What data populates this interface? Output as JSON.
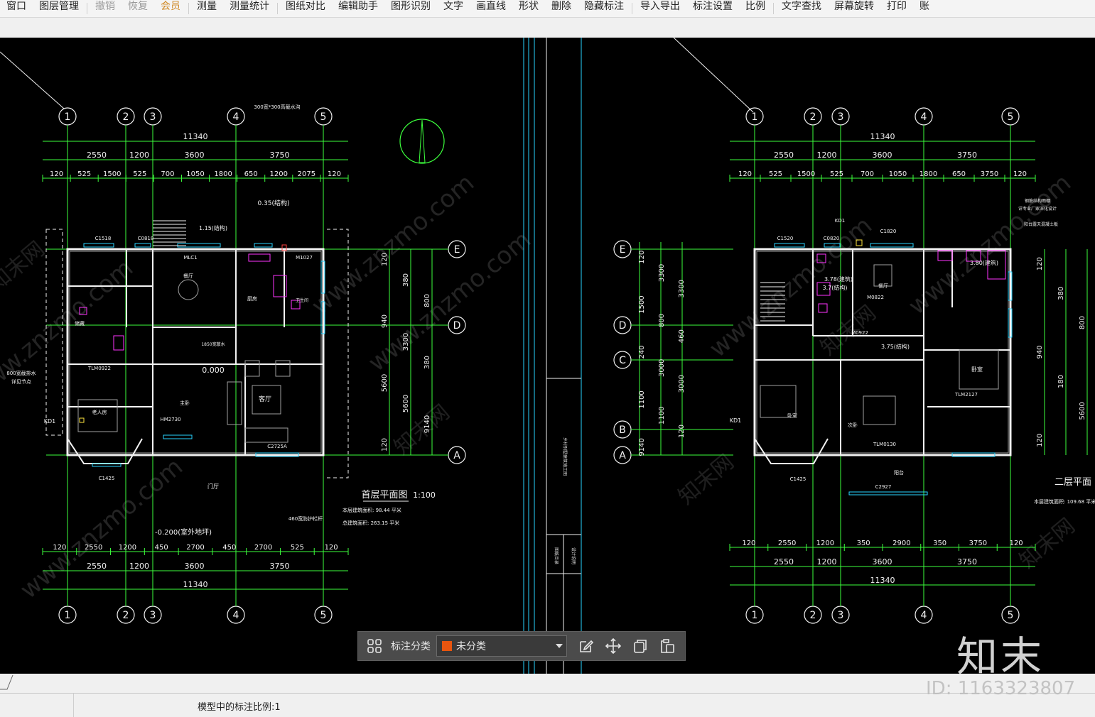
{
  "menu": {
    "items": [
      {
        "label": "窗口",
        "state": "normal"
      },
      {
        "label": "图层管理",
        "state": "normal"
      },
      {
        "label": "撤销",
        "state": "disabled"
      },
      {
        "label": "恢复",
        "state": "disabled"
      },
      {
        "label": "会员",
        "state": "vip"
      },
      {
        "label": "测量",
        "state": "normal"
      },
      {
        "label": "测量统计",
        "state": "normal"
      },
      {
        "label": "图纸对比",
        "state": "normal"
      },
      {
        "label": "编辑助手",
        "state": "normal"
      },
      {
        "label": "图形识别",
        "state": "normal"
      },
      {
        "label": "文字",
        "state": "normal"
      },
      {
        "label": "画直线",
        "state": "normal"
      },
      {
        "label": "形状",
        "state": "normal"
      },
      {
        "label": "删除",
        "state": "normal"
      },
      {
        "label": "隐藏标注",
        "state": "normal"
      },
      {
        "label": "导入导出",
        "state": "normal"
      },
      {
        "label": "标注设置",
        "state": "normal"
      },
      {
        "label": "比例",
        "state": "normal"
      },
      {
        "label": "文字查找",
        "state": "normal"
      },
      {
        "label": "屏幕旋转",
        "state": "normal"
      },
      {
        "label": "打印",
        "state": "normal"
      },
      {
        "label": "账",
        "state": "normal"
      }
    ]
  },
  "drawing": {
    "left": {
      "axis_cols": [
        "1",
        "2",
        "3",
        "4",
        "5"
      ],
      "axis_rows": [
        "E",
        "D",
        "A"
      ],
      "total": "11340",
      "top_dims": [
        "2550",
        "1200",
        "3600",
        "3750"
      ],
      "sub_dims": [
        "120",
        "525",
        "1500",
        "525",
        "700",
        "1050",
        "1800",
        "650",
        "1200",
        "2075",
        "120"
      ],
      "right_dims": [
        "120",
        "380",
        "800",
        "940",
        "3300",
        "380",
        "5600",
        "5600",
        "9140",
        "120"
      ],
      "bottom_dims_1": [
        "120",
        "2550",
        "1200",
        "450",
        "2700",
        "450",
        "2700",
        "525",
        "120"
      ],
      "bottom_dims_2": [
        "2550",
        "1200",
        "3600",
        "3750"
      ],
      "bottom_total": "11340",
      "room_labels": [
        "餐厅",
        "厨房",
        "客厅",
        "老人房",
        "卧室",
        "门厅",
        "次卧",
        "卫生间",
        "储藏"
      ],
      "window_labels": [
        "C1518",
        "C0818",
        "MLC1",
        "M1027",
        "C0824",
        "C1425",
        "C2725A",
        "M0922",
        "TLM0922",
        "HM2730",
        "KD1",
        "C0618",
        "C2718",
        "M0822"
      ],
      "elevations": [
        "0.000",
        "-0.020",
        "-0.200(室外地坪)",
        "1.15(结构)",
        "0.35(结构)"
      ],
      "notes": [
        "300宽*300高截水沟",
        "800宽截排水",
        "详见节点",
        "1850宽散水",
        "460宽防护栏杆"
      ],
      "title": "首层平面图",
      "scale": "1:100",
      "area_1": "本层建筑面积: 98.44 平米",
      "area_2": "总建筑面积: 263.15 平米"
    },
    "right": {
      "axis_cols": [
        "1",
        "2",
        "3",
        "4",
        "5"
      ],
      "axis_rows": [
        "E",
        "D",
        "C",
        "B",
        "A"
      ],
      "total": "11340",
      "top_dims": [
        "2550",
        "1200",
        "3600",
        "3750"
      ],
      "sub_dims": [
        "120",
        "525",
        "1500",
        "525",
        "700",
        "1050",
        "1800",
        "650",
        "3750",
        "120"
      ],
      "left_dims": [
        "120",
        "3300",
        "3300",
        "1500",
        "800",
        "460",
        "240",
        "3000",
        "3000",
        "1100",
        "1100",
        "120",
        "9140"
      ],
      "right_dims": [
        "120",
        "380",
        "800",
        "940",
        "180",
        "5600",
        "120"
      ],
      "bottom_dims_1": [
        "120",
        "2550",
        "1200",
        "350",
        "2900",
        "350",
        "3750",
        "120"
      ],
      "bottom_dims_2": [
        "2550",
        "1200",
        "3600",
        "3750"
      ],
      "bottom_total": "11340",
      "window_labels": [
        "C1520",
        "C0820",
        "C1820",
        "KD1",
        "M0822",
        "M0922",
        "TLM2127",
        "TLM0130",
        "C2927",
        "C1425",
        "C1527",
        "C0826"
      ],
      "elevations": [
        "3.78(建筑)",
        "3.7(结构)",
        "3.80(建筑)",
        "3.75(结构)"
      ],
      "notes": [
        "钢筋结构雨棚",
        "详专业厂家深化设计",
        "阳台露天混凝土板"
      ],
      "title": "二层平面",
      "area_1": "本层建筑面积: 109.68 平米"
    }
  },
  "floating_toolbar": {
    "label": "标注分类",
    "selected": "未分类",
    "swatch_color": "#e8550f"
  },
  "status": {
    "text": "模型中的标注比例:1"
  },
  "watermark": {
    "brand": "知末",
    "id": "ID: 1163323807",
    "site": "www.znzmo.com"
  }
}
